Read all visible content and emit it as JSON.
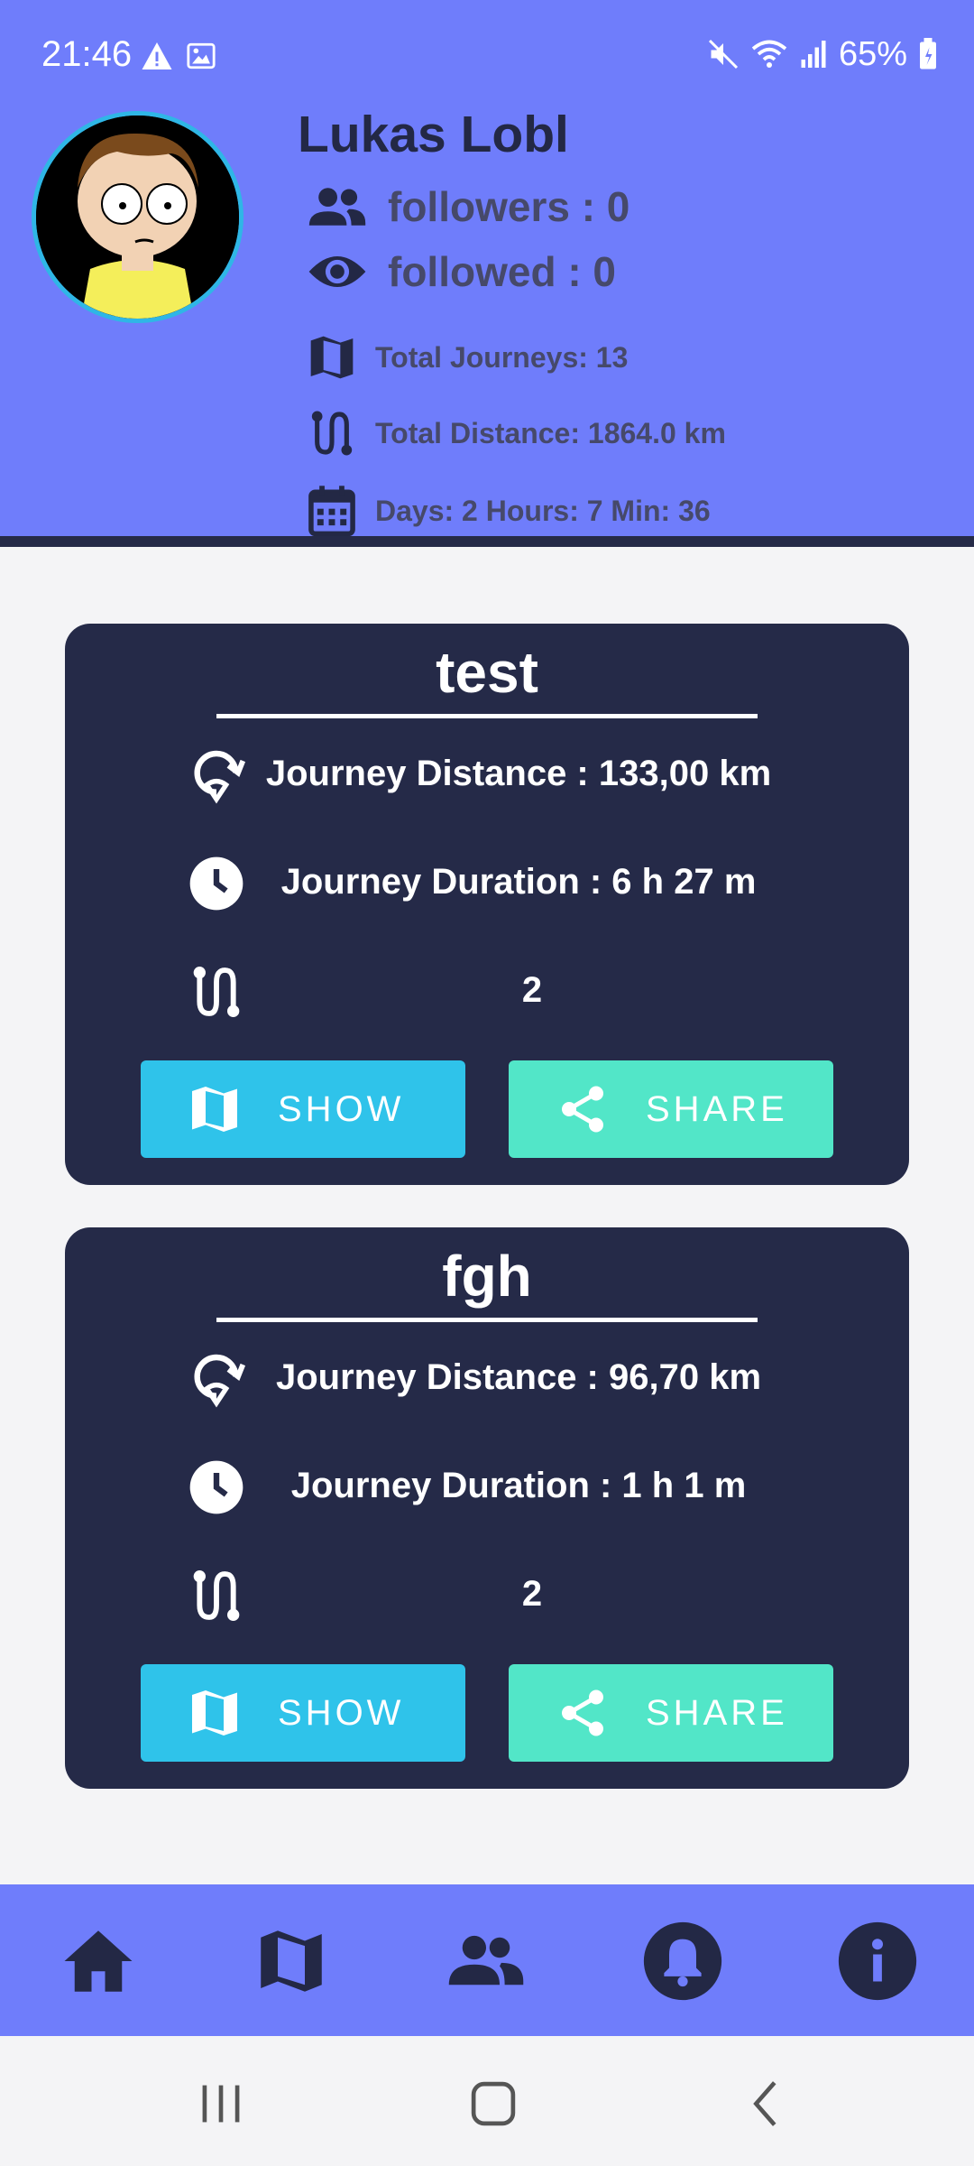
{
  "status_bar": {
    "time": "21:46",
    "battery": "65%",
    "icons": [
      "warning-icon",
      "image-icon",
      "mute-icon",
      "wifi-icon",
      "signal-icon",
      "battery-icon"
    ]
  },
  "profile": {
    "name": "Lukas Lobl",
    "followers": "followers : 0",
    "followed": "followed : 0",
    "total_journeys": "Total Journeys: 13",
    "total_distance": "Total Distance: 1864.0 km",
    "total_time": "Days: 2 Hours: 7  Min:  36"
  },
  "journeys": [
    {
      "title": "test",
      "distance": "Journey Distance : 133,00 km",
      "duration": "Journey Duration : 6 h 27 m",
      "stops": "2",
      "show_label": "SHOW",
      "share_label": "SHARE"
    },
    {
      "title": "fgh",
      "distance": "Journey Distance : 96,70 km",
      "duration": "Journey Duration : 1 h 1 m",
      "stops": "2",
      "show_label": "SHOW",
      "share_label": "SHARE"
    }
  ],
  "bottom_nav": [
    "home-icon",
    "map-icon",
    "people-icon",
    "bell-icon",
    "info-icon"
  ],
  "colors": {
    "header": "#6f7dfb",
    "card": "#252a48",
    "show_button": "#2fc3ea",
    "share_button": "#52e6c8"
  }
}
